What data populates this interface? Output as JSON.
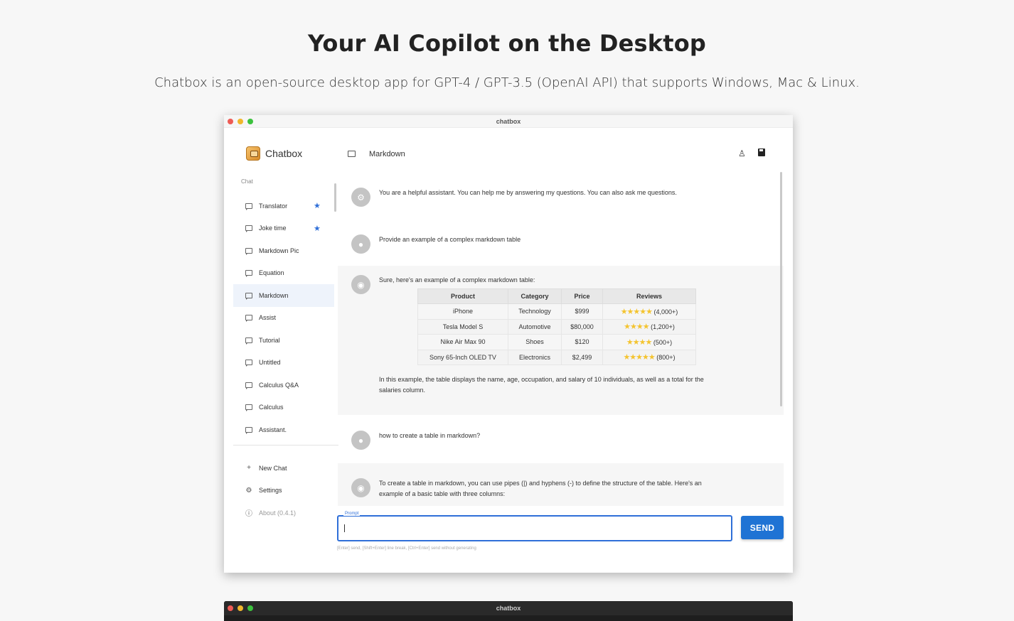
{
  "hero": {
    "title": "Your AI Copilot on the Desktop",
    "subtitle": "Chatbox is an open-source desktop app for GPT-4 / GPT-3.5 (OpenAI API) that supports Windows, Mac & Linux."
  },
  "window": {
    "title": "chatbox"
  },
  "sidebar": {
    "brand": "Chatbox",
    "section_label": "Chat",
    "chats": [
      {
        "label": "Translator",
        "starred": true
      },
      {
        "label": "Joke time",
        "starred": true
      },
      {
        "label": "Markdown Pic",
        "starred": false
      },
      {
        "label": "Equation",
        "starred": false
      },
      {
        "label": "Markdown",
        "starred": false,
        "active": true
      },
      {
        "label": "Assist",
        "starred": false
      },
      {
        "label": "Tutorial",
        "starred": false
      },
      {
        "label": "Untitled",
        "starred": false
      },
      {
        "label": "Calculus Q&A",
        "starred": false
      },
      {
        "label": "Calculus",
        "starred": false
      },
      {
        "label": "Assistant.",
        "starred": false
      }
    ],
    "actions": {
      "new_chat": "New Chat",
      "settings": "Settings",
      "about": "About (0.4.1)"
    }
  },
  "topbar": {
    "title": "Markdown"
  },
  "messages": {
    "system": "You are a helpful assistant. You can help me by answering my questions. You can also ask me questions.",
    "user1": "Provide an example of a complex markdown table",
    "assistant1_intro": "Sure, here's an example of a complex markdown table:",
    "table": {
      "headers": [
        "Product",
        "Category",
        "Price",
        "Reviews"
      ],
      "rows": [
        {
          "product": "iPhone",
          "category": "Technology",
          "price": "$999",
          "stars": "★★★★★",
          "count": "(4,000+)"
        },
        {
          "product": "Tesla Model S",
          "category": "Automotive",
          "price": "$80,000",
          "stars": "★★★★",
          "count": "(1,200+)"
        },
        {
          "product": "Nike Air Max 90",
          "category": "Shoes",
          "price": "$120",
          "stars": "★★★★",
          "count": "(500+)"
        },
        {
          "product": "Sony 65-Inch OLED TV",
          "category": "Electronics",
          "price": "$2,499",
          "stars": "★★★★★",
          "count": "(800+)"
        }
      ]
    },
    "assistant1_outro": "In this example, the table displays the name, age, occupation, and salary of 10 individuals, as well as a total for the salaries column.",
    "user2": "how to create a table in markdown?",
    "assistant2": "To create a table in markdown, you can use pipes (|) and hyphens (-) to define the structure of the table. Here's an example of a basic table with three columns:"
  },
  "prompt": {
    "label": "Prompt",
    "value": "",
    "send_label": "SEND",
    "hint": "[Enter] send, [Shift+Enter] line break, [Ctrl+Enter] send without generating"
  },
  "window2": {
    "title": "chatbox"
  },
  "colors": {
    "accent": "#1f73d4",
    "star": "#2f6fd8"
  }
}
